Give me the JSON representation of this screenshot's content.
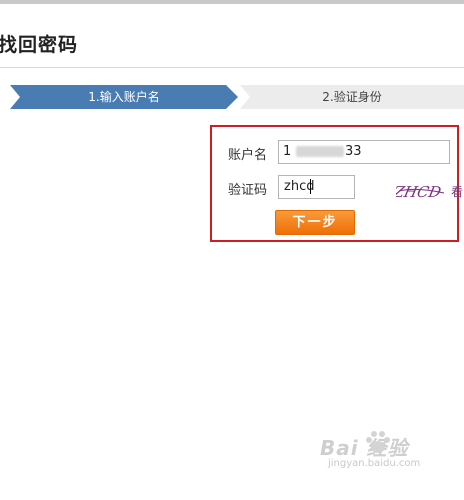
{
  "page": {
    "title": "找回密码"
  },
  "steps": [
    {
      "label": "1.输入账户名",
      "active": true
    },
    {
      "label": "2.验证身份",
      "active": false
    }
  ],
  "form": {
    "account_label": "账户名",
    "account_value_prefix": "1",
    "account_value_suffix": "33",
    "captcha_label": "验证码",
    "captcha_value": "zhcd",
    "captcha_image_text": "ZHCD",
    "captcha_side_text": "看",
    "next_button": "下一步"
  },
  "watermark": {
    "brand": "Bai 经验",
    "url": "jingyan.baidu.com"
  },
  "colors": {
    "step_active": "#4a7cb4",
    "step_inactive": "#ececec",
    "highlight": "#cc1e23",
    "button_top": "#fa9a3a",
    "button_bottom": "#ef6f06"
  }
}
